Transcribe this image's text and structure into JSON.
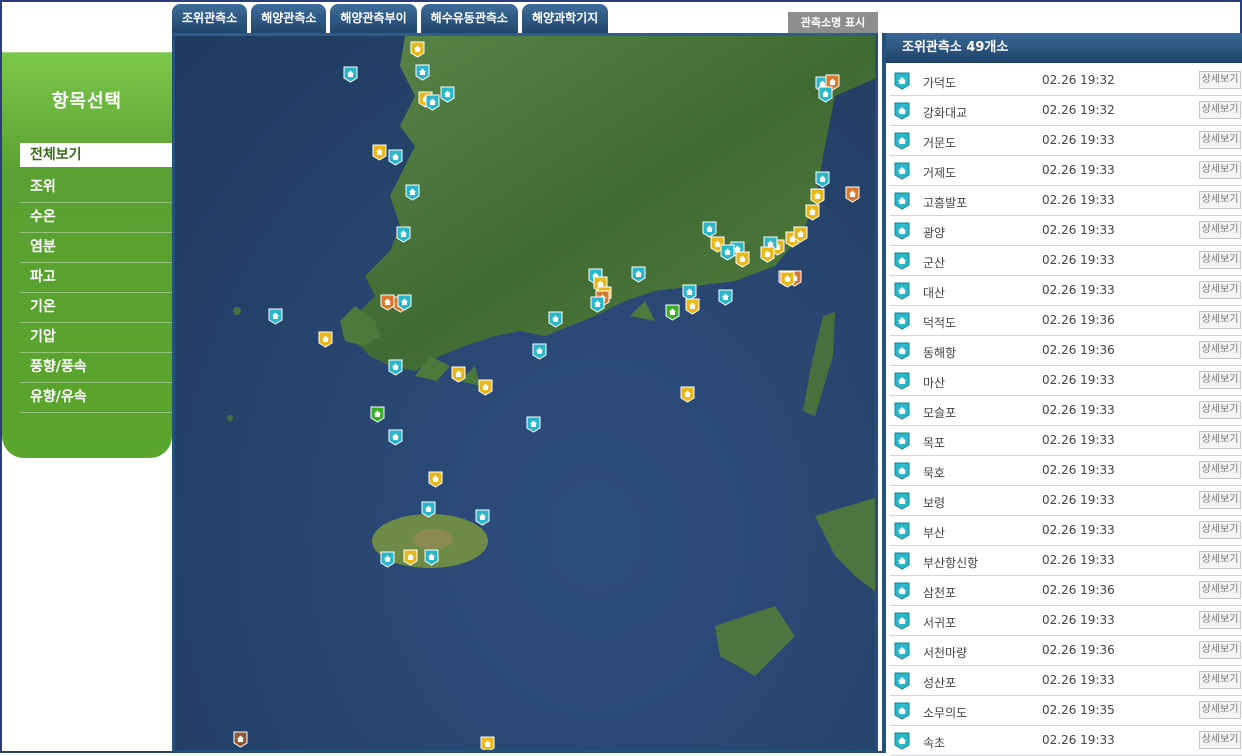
{
  "left_menu": {
    "title": "항목선택",
    "items": [
      "전체보기",
      "조위",
      "수온",
      "염분",
      "파고",
      "기온",
      "기압",
      "풍향/풍속",
      "유향/유속"
    ]
  },
  "tabs": [
    "조위관측소",
    "해양관측소",
    "해양관측부이",
    "해수유동관측소",
    "해양과학기지"
  ],
  "toggle_names_label": "관측소명 표시",
  "right_panel": {
    "header": "조위관측소 49개소",
    "detail_label": "상세보기",
    "stations": [
      {
        "name": "가덕도",
        "time": "02.26 19:32"
      },
      {
        "name": "강화대교",
        "time": "02.26 19:32"
      },
      {
        "name": "거문도",
        "time": "02.26 19:33"
      },
      {
        "name": "거제도",
        "time": "02.26 19:33"
      },
      {
        "name": "고흥발포",
        "time": "02.26 19:33"
      },
      {
        "name": "광양",
        "time": "02.26 19:33"
      },
      {
        "name": "군산",
        "time": "02.26 19:33"
      },
      {
        "name": "대산",
        "time": "02.26 19:33"
      },
      {
        "name": "덕적도",
        "time": "02.26 19:36"
      },
      {
        "name": "동해항",
        "time": "02.26 19:36"
      },
      {
        "name": "마산",
        "time": "02.26 19:33"
      },
      {
        "name": "모슬포",
        "time": "02.26 19:33"
      },
      {
        "name": "목포",
        "time": "02.26 19:33"
      },
      {
        "name": "묵호",
        "time": "02.26 19:33"
      },
      {
        "name": "보령",
        "time": "02.26 19:33"
      },
      {
        "name": "부산",
        "time": "02.26 19:33"
      },
      {
        "name": "부산항신항",
        "time": "02.26 19:33"
      },
      {
        "name": "삼천포",
        "time": "02.26 19:36"
      },
      {
        "name": "서귀포",
        "time": "02.26 19:33"
      },
      {
        "name": "서천마량",
        "time": "02.26 19:36"
      },
      {
        "name": "성산포",
        "time": "02.26 19:33"
      },
      {
        "name": "소무의도",
        "time": "02.26 19:35"
      },
      {
        "name": "속초",
        "time": "02.26 19:33"
      }
    ]
  },
  "map": {
    "icons": {
      "tide": "tide-station-icon",
      "ocean": "ocean-station-icon",
      "buoy": "ocean-buoy-icon",
      "flow": "current-station-icon",
      "base": "science-base-icon"
    },
    "colors": {
      "tide": "#2bb6c9",
      "ocean": "#e8b71c",
      "buoy": "#d9792e",
      "flow": "#3cae2a",
      "base": "#8a5a3a",
      "sea": "#27456f",
      "land": "#4d7a3e"
    }
  },
  "colors": {
    "menu_green": "#5aa52c",
    "tab_blue": "#21456b",
    "header_blue": "#1f4268",
    "frame_border": "#2c3e7a"
  }
}
